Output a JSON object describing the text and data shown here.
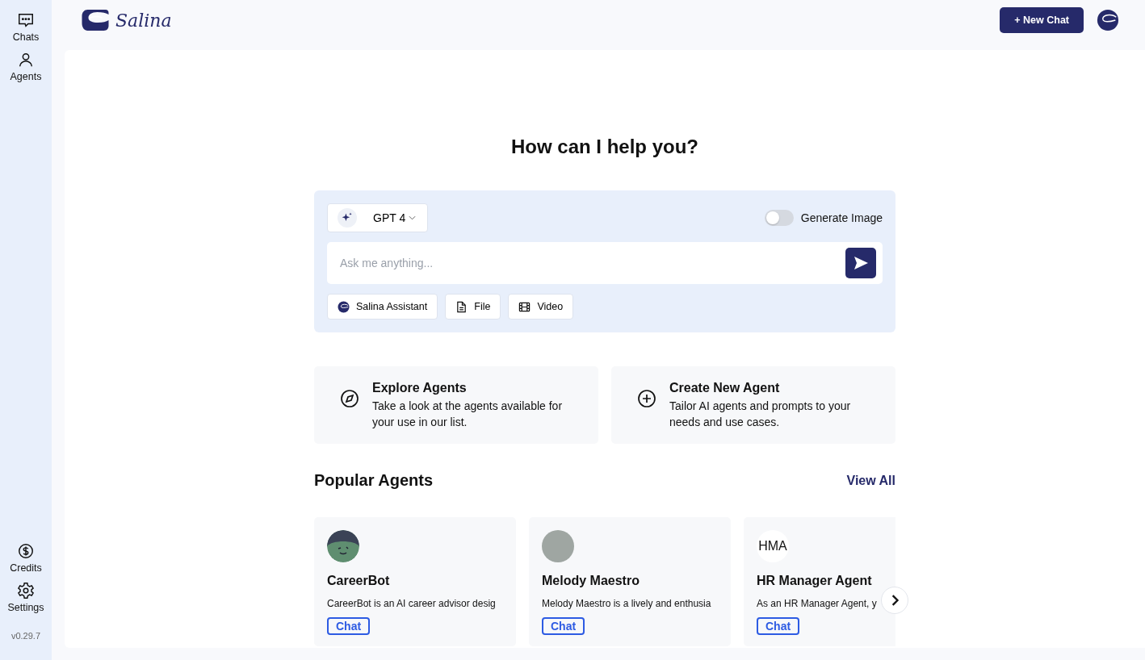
{
  "sidebar": {
    "top_items": [
      {
        "label": "Chats",
        "kind": "chat"
      },
      {
        "label": "Agents",
        "kind": "user"
      }
    ],
    "bottom_items": [
      {
        "label": "Credits",
        "kind": "dollar"
      },
      {
        "label": "Settings",
        "kind": "gear"
      }
    ],
    "version": "v0.29.7"
  },
  "header": {
    "logo": "Salina",
    "new_chat_button": "+ New Chat"
  },
  "heading": "How can I help you?",
  "composer": {
    "model": "GPT 4",
    "generate_image": {
      "label": "Generate Image",
      "on": false
    },
    "placeholder": "Ask me anything...",
    "attachments": [
      {
        "label": "Salina Assistant",
        "kind": "logo"
      },
      {
        "label": "File",
        "kind": "file"
      },
      {
        "label": "Video",
        "kind": "film"
      }
    ]
  },
  "actions": [
    {
      "title": "Explore Agents",
      "description": "Take a look at the agents available for your use in our list.",
      "kind": "compass"
    },
    {
      "title": "Create New Agent",
      "description": "Tailor AI agents and prompts to your needs and use cases.",
      "kind": "plus"
    }
  ],
  "popular": {
    "title": "Popular Agents",
    "view_all": "View All",
    "agents": [
      {
        "name": "CareerBot",
        "description": "CareerBot is an AI career advisor desig",
        "kind": "bot",
        "button": "Chat"
      },
      {
        "name": "Melody Maestro",
        "description": "Melody Maestro is a lively and enthusia",
        "kind": "photo",
        "button": "Chat"
      },
      {
        "name": "HR Manager Agent",
        "description": "As an HR Manager Agent, y",
        "kind": "initials",
        "initials": "HMA",
        "button": "Chat"
      }
    ]
  }
}
